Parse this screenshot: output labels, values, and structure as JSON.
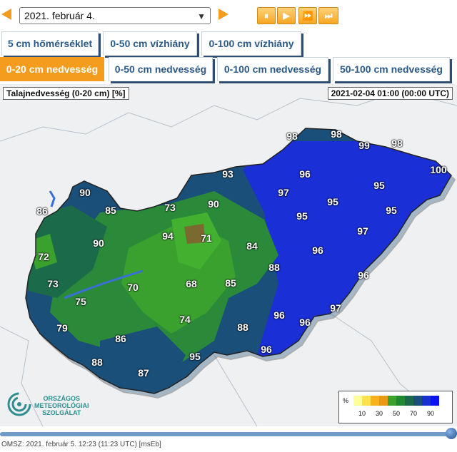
{
  "toolbar": {
    "date_selected": "2021. február 4.",
    "play_buttons": [
      "⏸",
      "▶",
      "⏩",
      "⏭"
    ]
  },
  "tabs_row1": [
    "5 cm hőmérséklet",
    "0-50 cm vízhiány",
    "0-100 cm vízhiány"
  ],
  "tabs_row2": [
    "0-20 cm nedvesség",
    "0-50 cm nedvesség",
    "0-100 cm nedvesség",
    "50-100 cm nedvesség"
  ],
  "active_tab": "0-20 cm nedvesség",
  "map": {
    "title": "Talajnedvesség (0-20 cm) [%]",
    "timestamp": "2021-02-04 01:00 (00:00 UTC)",
    "values": [
      "98",
      "98",
      "99",
      "98",
      "100",
      "93",
      "96",
      "95",
      "97",
      "95",
      "86",
      "90",
      "85",
      "73",
      "90",
      "95",
      "95",
      "94",
      "71",
      "97",
      "84",
      "72",
      "90",
      "88",
      "96",
      "73",
      "70",
      "68",
      "85",
      "96",
      "75",
      "97",
      "79",
      "74",
      "88",
      "96",
      "96",
      "86",
      "95",
      "88",
      "87"
    ]
  },
  "legend": {
    "unit": "%",
    "ticks": [
      "10",
      "30",
      "50",
      "70",
      "90"
    ],
    "colors": [
      "#ffff99",
      "#ffe14d",
      "#f7b21c",
      "#e89a10",
      "#3aa02e",
      "#1f8a2e",
      "#1b6a4a",
      "#1a4f7a",
      "#1731d0",
      "#0a14f0"
    ]
  },
  "logo": {
    "line1": "ORSZÁGOS",
    "line2": "METEOROLÓGIAI",
    "line3": "SZOLGÁLAT"
  },
  "footer": "OMSZ: 2021. február 5. 12:23 (11:23 UTC)  [msEb]"
}
